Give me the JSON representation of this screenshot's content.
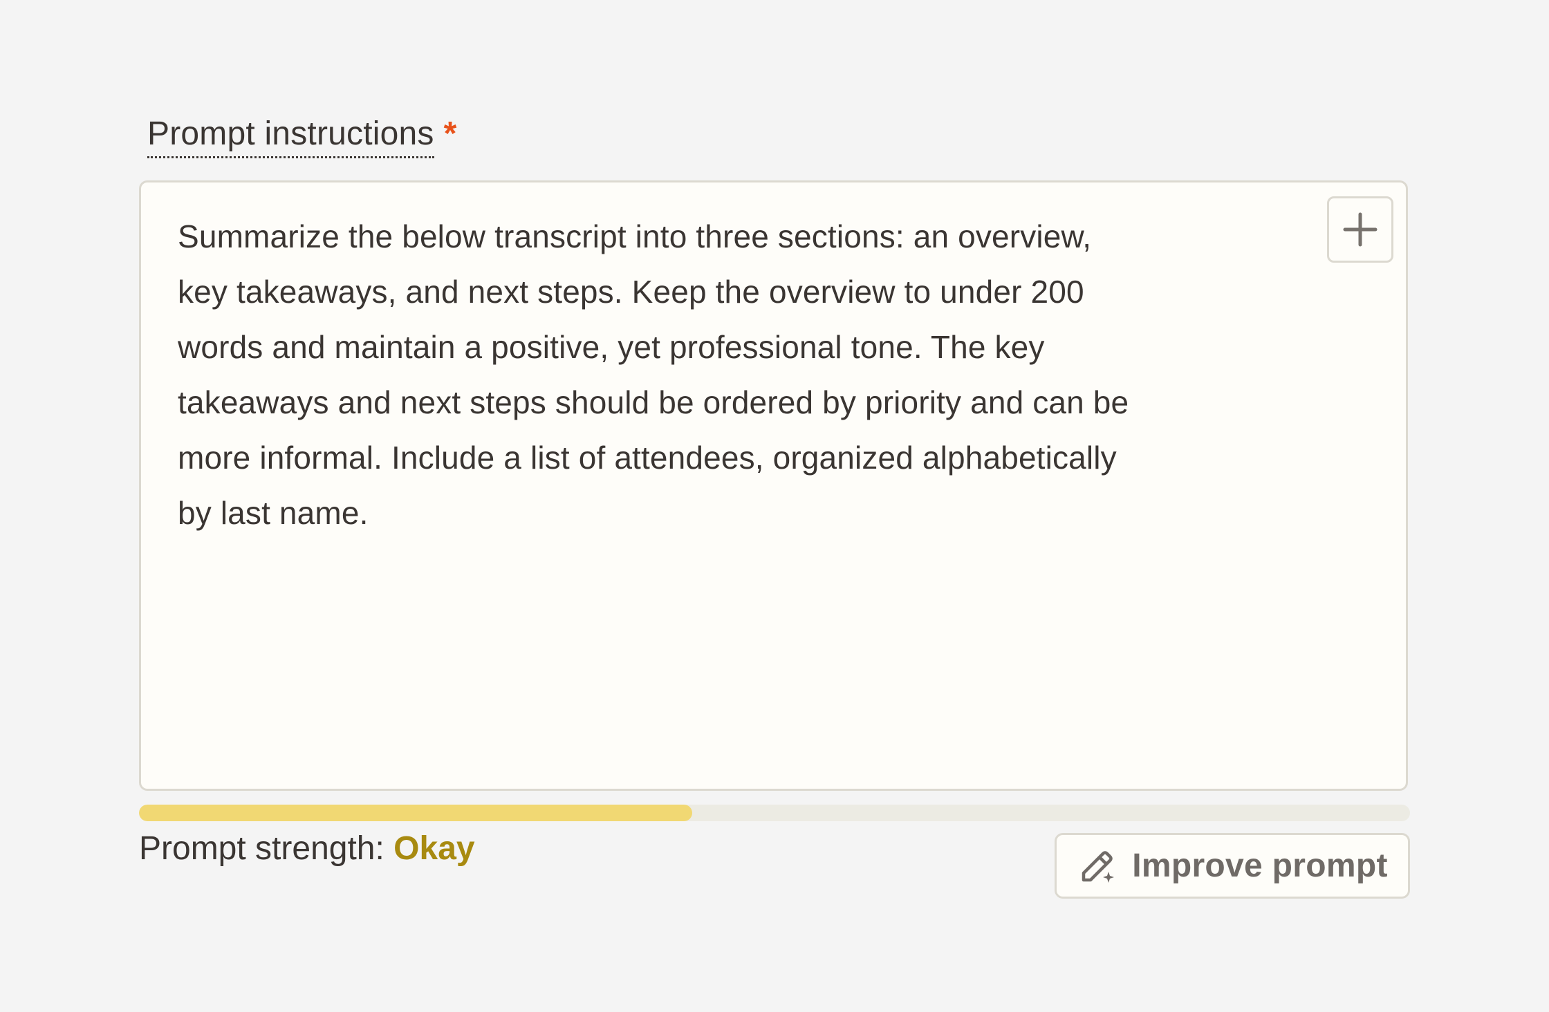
{
  "field": {
    "label": "Prompt instructions",
    "required_marker": "*"
  },
  "textarea": {
    "value": "Summarize the below transcript into three sections: an overview,\nkey takeaways, and next steps. Keep the overview to under 200\nwords and maintain a positive, yet professional tone. The key\ntakeaways and next steps should be ordered by priority and can be\nmore informal. Include a list of attendees, organized alphabetically\nby last name."
  },
  "add_button": {
    "icon": "plus-icon"
  },
  "strength": {
    "label": "Prompt strength:",
    "value": "Okay",
    "level_percent": 43.5,
    "fill_color": "#f1d873",
    "value_color": "#a88a10"
  },
  "improve_button": {
    "label": "Improve prompt",
    "icon": "pencil-sparkle-icon"
  },
  "colors": {
    "required": "#e8521a",
    "background": "#f4f4f4",
    "textarea_bg": "#fefdf9"
  }
}
